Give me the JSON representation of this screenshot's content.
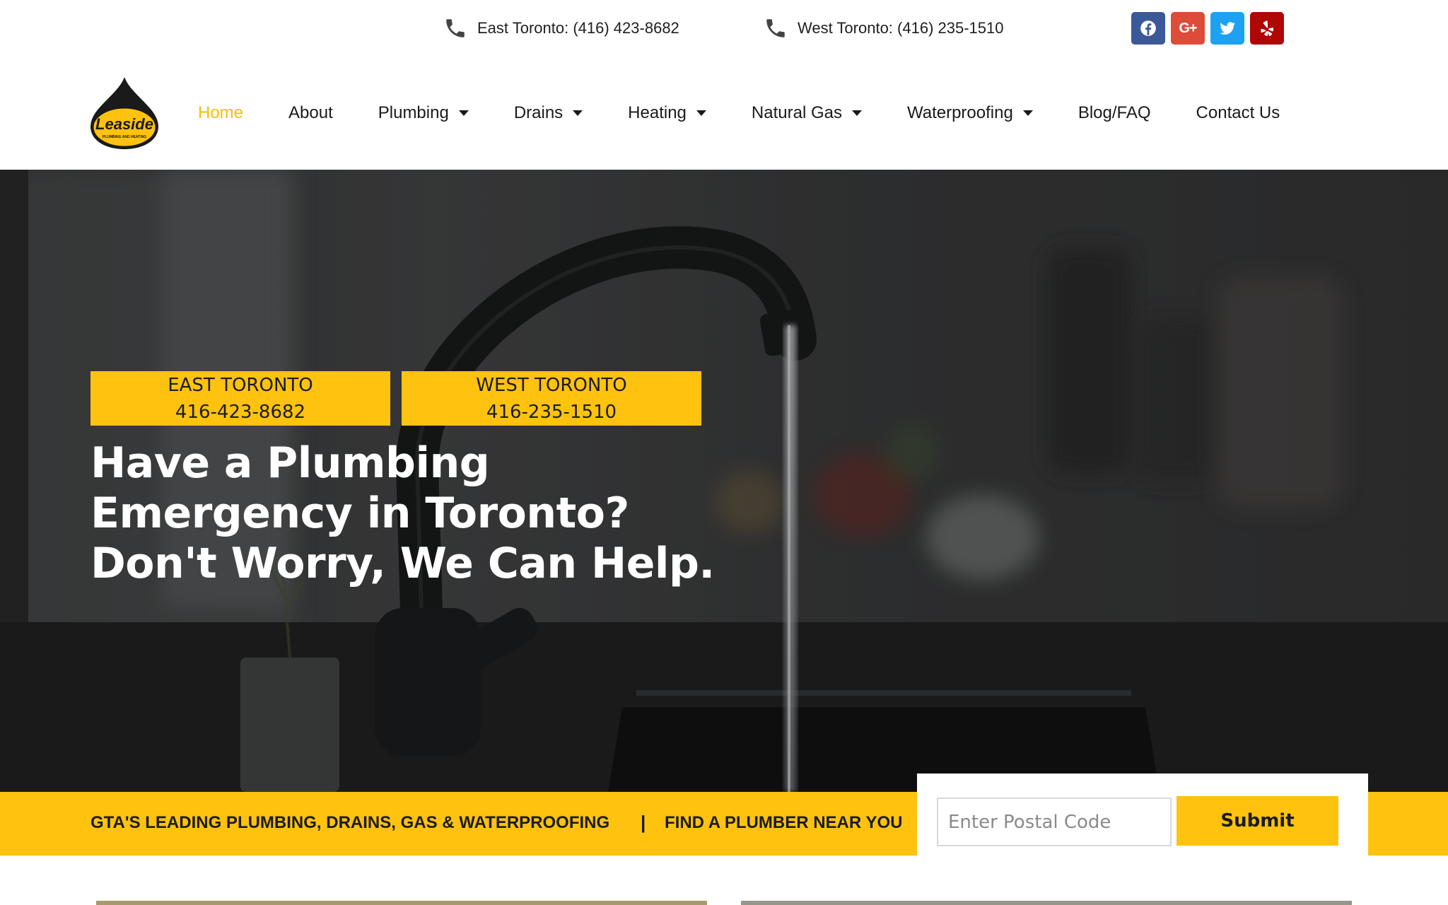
{
  "topbar": {
    "east_phone": "East Toronto: (416) 423-8682",
    "west_phone": "West Toronto: (416) 235-1510",
    "socials": [
      {
        "name": "facebook-icon",
        "color": "#3b5998"
      },
      {
        "name": "google-plus-icon",
        "color": "#dd4b39",
        "glyph": "G+"
      },
      {
        "name": "twitter-icon",
        "color": "#1da1f2"
      },
      {
        "name": "yelp-icon",
        "color": "#af0606"
      }
    ]
  },
  "logo": {
    "text": "Leaside",
    "subtext": "PLUMBING AND HEATING",
    "icon": "oil-drop-logo"
  },
  "nav": {
    "items": [
      {
        "label": "Home",
        "active": true,
        "dropdown": false
      },
      {
        "label": "About",
        "dropdown": false
      },
      {
        "label": "Plumbing",
        "dropdown": true
      },
      {
        "label": "Drains",
        "dropdown": true
      },
      {
        "label": "Heating",
        "dropdown": true
      },
      {
        "label": "Natural Gas",
        "dropdown": true
      },
      {
        "label": "Waterproofing",
        "dropdown": true
      },
      {
        "label": "Blog/FAQ",
        "dropdown": false
      },
      {
        "label": "Contact Us",
        "dropdown": false
      }
    ]
  },
  "hero": {
    "east_label": "EAST TORONTO",
    "east_number": "416-423-8682",
    "west_label": "WEST TORONTO",
    "west_number": "416-235-1510",
    "headline_line1": "Have a Plumbing",
    "headline_line2": "Emergency in Toronto?",
    "headline_line3": "Don't Worry, We Can Help."
  },
  "strip": {
    "tagline": "GTA'S LEADING PLUMBING, DRAINS, GAS & WATERPROOFING",
    "separator": "|",
    "find_label": "FIND A PLUMBER NEAR YOU",
    "postal_placeholder": "Enter Postal Code",
    "submit_label": "Submit"
  },
  "colors": {
    "accent": "#fec20f",
    "active_nav": "#f7be00",
    "text": "#1a1a1a"
  }
}
